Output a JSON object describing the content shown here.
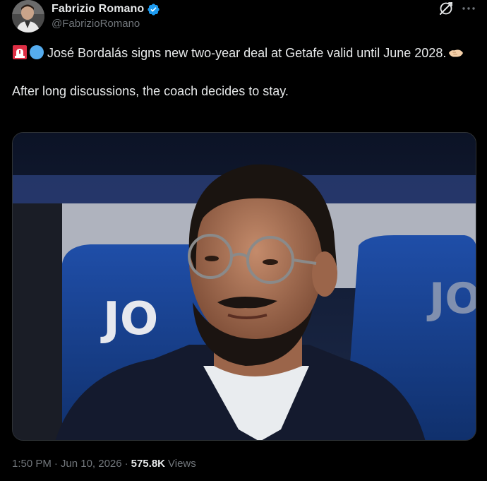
{
  "author": {
    "display_name": "Fabrizio Romano",
    "handle": "@FabrizioRomano",
    "verified": true,
    "verified_color": "#1d9bf0"
  },
  "tweet": {
    "line1": "José Bordalás signs new two-year deal at Getafe valid until June 2028.",
    "line2": "After long discussions, the coach decides to stay.",
    "emojis": [
      "rotating-light",
      "blue-circle",
      "handshake"
    ]
  },
  "media": {
    "seat_text": "JO"
  },
  "meta": {
    "time": "1:50 PM",
    "separator1": "·",
    "date": "Jun 10, 2026",
    "separator2": "·",
    "views_count": "575.8K",
    "views_label": "Views"
  },
  "colors": {
    "background": "#000000",
    "text": "#e7e9ea",
    "muted": "#71767b",
    "border": "#2f3336"
  }
}
